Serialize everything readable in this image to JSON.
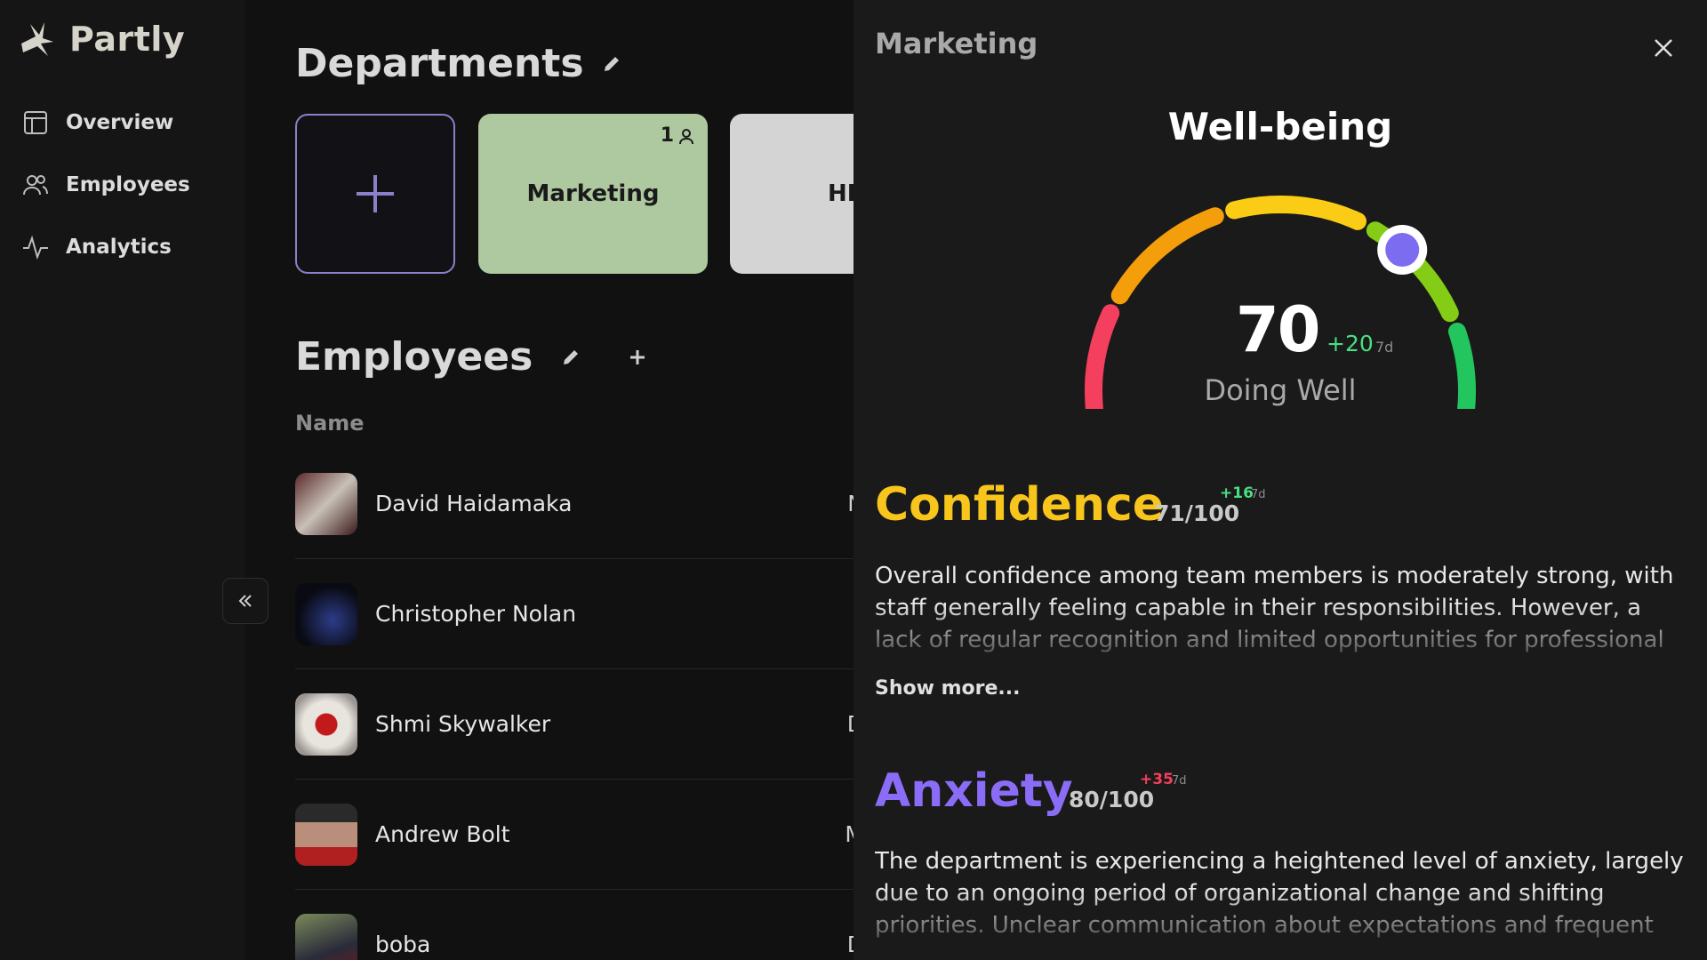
{
  "app": {
    "name": "Partly"
  },
  "sidebar": {
    "items": [
      {
        "label": "Overview",
        "icon": "layout-icon"
      },
      {
        "label": "Employees",
        "icon": "users-icon"
      },
      {
        "label": "Analytics",
        "icon": "activity-icon"
      }
    ]
  },
  "departments": {
    "title": "Departments",
    "cards": [
      {
        "name": "Marketing",
        "count": "1",
        "color": "#aec89f"
      },
      {
        "name": "HR",
        "color": "#d4d4d4"
      }
    ]
  },
  "employees": {
    "title": "Employees",
    "column_name": "Name",
    "rows": [
      {
        "name": "David Haidamaka",
        "extra": "N"
      },
      {
        "name": "Christopher Nolan",
        "extra": ""
      },
      {
        "name": "Shmi Skywalker",
        "extra": "D"
      },
      {
        "name": "Andrew Bolt",
        "extra": "M"
      },
      {
        "name": "boba",
        "extra": "D"
      }
    ]
  },
  "panel": {
    "title": "Marketing",
    "wellbeing": {
      "title": "Well-being",
      "score": "70",
      "score_fraction": 0.7,
      "delta": "+20",
      "period": "7d",
      "status": "Doing Well"
    },
    "confidence": {
      "title": "Confidence",
      "score": "71/100",
      "delta": "+16",
      "period": "7d",
      "color": "#f8c51c",
      "text": "Overall confidence among team members is moderately strong, with staff generally feeling capable in their responsibilities. However, a lack of regular recognition and limited opportunities for professional development",
      "show_more": "Show more..."
    },
    "anxiety": {
      "title": "Anxiety",
      "score": "80/100",
      "delta": "+35",
      "period": "7d",
      "color": "#8b6cf6",
      "text": "The department is experiencing a heightened level of anxiety, largely due to an ongoing period of organizational change and shifting priorities. Unclear communication about expectations and frequent changes in"
    }
  }
}
